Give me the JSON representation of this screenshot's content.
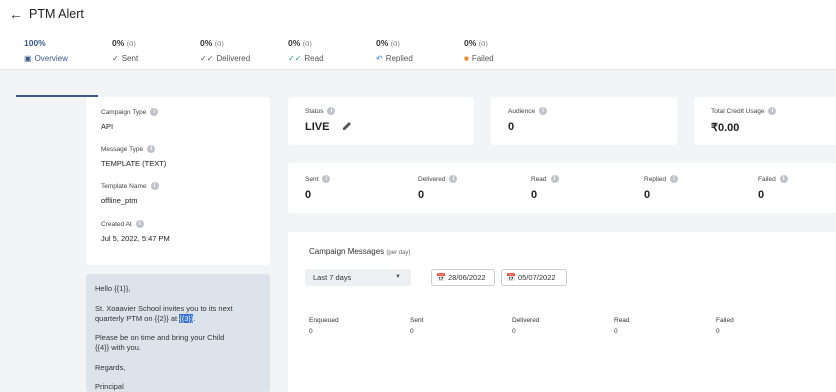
{
  "header": {
    "back_icon": "arrow-left-icon",
    "title": "PTM Alert"
  },
  "tabs": [
    {
      "pct": "100%",
      "count": "",
      "label": "Overview",
      "icon": "overview-icon"
    },
    {
      "pct": "0%",
      "count": "(0)",
      "label": "Sent",
      "icon": "check-icon"
    },
    {
      "pct": "0%",
      "count": "(0)",
      "label": "Delivered",
      "icon": "double-check-icon"
    },
    {
      "pct": "0%",
      "count": "(0)",
      "label": "Read",
      "icon": "double-check-green-icon"
    },
    {
      "pct": "0%",
      "count": "(0)",
      "label": "Replied",
      "icon": "reply-icon"
    },
    {
      "pct": "0%",
      "count": "(0)",
      "label": "Failed",
      "icon": "failed-icon"
    }
  ],
  "info": {
    "campaign_type_label": "Campaign Type",
    "campaign_type": "API",
    "message_type_label": "Message Type",
    "message_type": "TEMPLATE (TEXT)",
    "template_name_label": "Template Name",
    "template_name": "offline_ptm",
    "created_at_label": "Created At",
    "created_at": "Jul 5, 2022, 5:47 PM"
  },
  "message": {
    "line1": "Hello {{1}},",
    "line2": "St. Xoaavier School invites you to its next",
    "line3a": "quarterly PTM on {{2}} at ",
    "line3b": "{{3}}",
    "line3c": ".",
    "line4": "Please be on time and bring your Child",
    "line5": "{{4}} with you.",
    "line6": "Regards,",
    "line7": "Principal"
  },
  "stats": {
    "status_label": "Status",
    "status_value": "LIVE",
    "audience_label": "Audience",
    "audience_value": "0",
    "credit_label": "Total Credit Usage",
    "credit_value": "₹0.00"
  },
  "counts": [
    {
      "label": "Sent",
      "value": "0"
    },
    {
      "label": "Delivered",
      "value": "0"
    },
    {
      "label": "Read",
      "value": "0"
    },
    {
      "label": "Replied",
      "value": "0"
    },
    {
      "label": "Failed",
      "value": "0"
    }
  ],
  "campaign": {
    "title": "Campaign Messages",
    "subtitle": "(per day)",
    "range": "Last 7 days",
    "date_from": "28/06/2022",
    "date_to": "05/07/2022",
    "columns": [
      "Enqueued",
      "Sent",
      "Delivered",
      "Read",
      "Failed"
    ],
    "values": [
      "0",
      "0",
      "0",
      "0",
      "0"
    ]
  }
}
